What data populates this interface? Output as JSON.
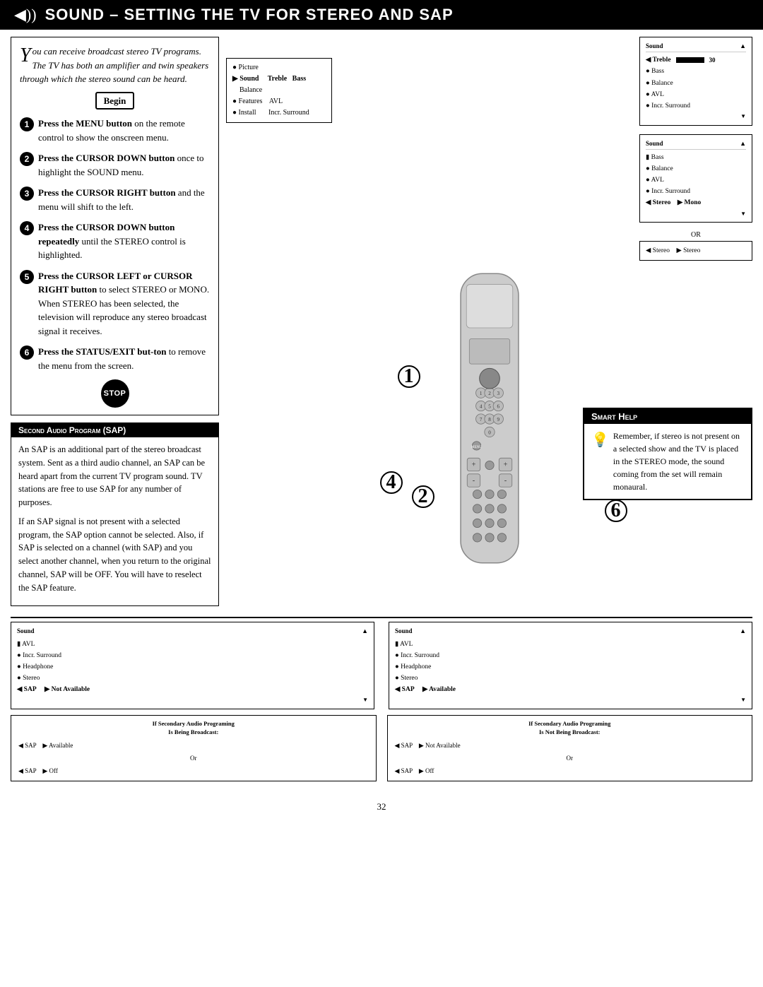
{
  "header": {
    "icon": "◀",
    "sound_icon": "◀))",
    "title": "Sound – Setting the TV for Stereo and SAP"
  },
  "intro": {
    "drop_cap": "Y",
    "text": "ou can receive broadcast stereo TV programs. The TV has both an amplifier and twin speakers through which the stereo sound can be heard."
  },
  "begin_label": "Begin",
  "steps": [
    {
      "num": "1",
      "text_bold": "Press the MENU button",
      "text_rest": " on the remote control to show the onscreen menu."
    },
    {
      "num": "2",
      "text_bold": "Press the CURSOR DOWN",
      "text_rest": " button once to highlight the SOUND menu."
    },
    {
      "num": "3",
      "text_bold": "Press the CURSOR RIGHT",
      "text_rest": " button and the menu will shift to the left."
    },
    {
      "num": "4",
      "text_bold": "Press the CURSOR DOWN",
      "text_rest": " button repeatedly until the STEREO control is highlighted."
    },
    {
      "num": "5",
      "text_bold": "Press the CURSOR LEFT or CURSOR RIGHT button",
      "text_rest": " to select STEREO or MONO. When STEREO has been selected, the television will reproduce any stereo broadcast signal it receives."
    },
    {
      "num": "6",
      "text_bold": "Press the STATUS/EXIT but-ton",
      "text_rest": " to remove the menu from the screen."
    }
  ],
  "stop_label": "STOP",
  "sap_section": {
    "header": "Second Audio Program (SAP)",
    "paragraphs": [
      "An SAP is an additional part of the stereo broadcast system. Sent as a third audio channel, an SAP can be heard apart from the current TV program sound. TV stations are free to use SAP for any number of purposes.",
      "If an SAP signal is not present with a selected program, the SAP option cannot be selected. Also, if SAP is selected on a channel (with SAP) and you select another channel, when you return to the original channel, SAP will be OFF. You will have to reselect the SAP feature."
    ]
  },
  "left_menu": {
    "items": [
      {
        "label": "● Picture",
        "active": false
      },
      {
        "label": "▶ Sound",
        "active": true
      },
      {
        "label": "● Features",
        "active": false
      },
      {
        "label": "● Install",
        "active": false
      }
    ],
    "sub_items": [
      "Treble",
      "Bass",
      "Balance",
      "AVL",
      "Incr. Surround"
    ]
  },
  "sound_menu1": {
    "title": "Sound",
    "items": [
      {
        "label": "Treble",
        "selected": true,
        "value": "30",
        "has_bar": true
      },
      {
        "label": "Bass",
        "selected": false
      },
      {
        "label": "Balance",
        "selected": false
      },
      {
        "label": "AVL",
        "selected": false
      },
      {
        "label": "Incr. Surround",
        "selected": false
      }
    ]
  },
  "sound_menu2": {
    "title": "Sound",
    "items": [
      {
        "label": "Bass",
        "selected": true
      },
      {
        "label": "Balance",
        "selected": false
      },
      {
        "label": "AVL",
        "selected": false
      },
      {
        "label": "Incr. Surround",
        "selected": false
      },
      {
        "label": "Stereo",
        "selected": true,
        "right_label": "Mono"
      }
    ]
  },
  "or_stereo": {
    "left": "◀ Stereo",
    "right": "▶ Stereo"
  },
  "smart_help": {
    "header": "Smart Help",
    "icon": "💡",
    "text": "Remember, if stereo is not present on a selected show and the TV is placed in the STEREO mode, the sound coming from the set will remain monaural."
  },
  "bottom_menus": [
    {
      "title": "Sound",
      "items": [
        {
          "label": "AVL",
          "selected": false
        },
        {
          "label": "Incr. Surround",
          "selected": false
        },
        {
          "label": "Headphone",
          "selected": false
        },
        {
          "label": "Stereo",
          "selected": false
        },
        {
          "label": "SAP",
          "selected": true,
          "right_label": "Not Available"
        }
      ]
    },
    {
      "title": "Sound",
      "items": [
        {
          "label": "AVL",
          "selected": false
        },
        {
          "label": "Incr. Surround",
          "selected": false
        },
        {
          "label": "Headphone",
          "selected": false
        },
        {
          "label": "Stereo",
          "selected": false
        },
        {
          "label": "SAP",
          "selected": true,
          "right_label": "Available"
        }
      ]
    }
  ],
  "sap_tables": [
    {
      "title": "If Secondary Audio Programing Is Being Broadcast:",
      "rows": [
        {
          "left": "◀ SAP",
          "right": "▶ Available"
        },
        {
          "or": "Or"
        },
        {
          "left": "◀ SAP",
          "right": "▶ Off"
        }
      ]
    },
    {
      "title": "If Secondary Audio Programing Is Not Being Broadcast:",
      "rows": [
        {
          "left": "◀ SAP",
          "right": "▶ Not Available"
        },
        {
          "or": "Or"
        },
        {
          "left": "◀ SAP",
          "right": "▶ Off"
        }
      ]
    }
  ],
  "page_number": "32"
}
